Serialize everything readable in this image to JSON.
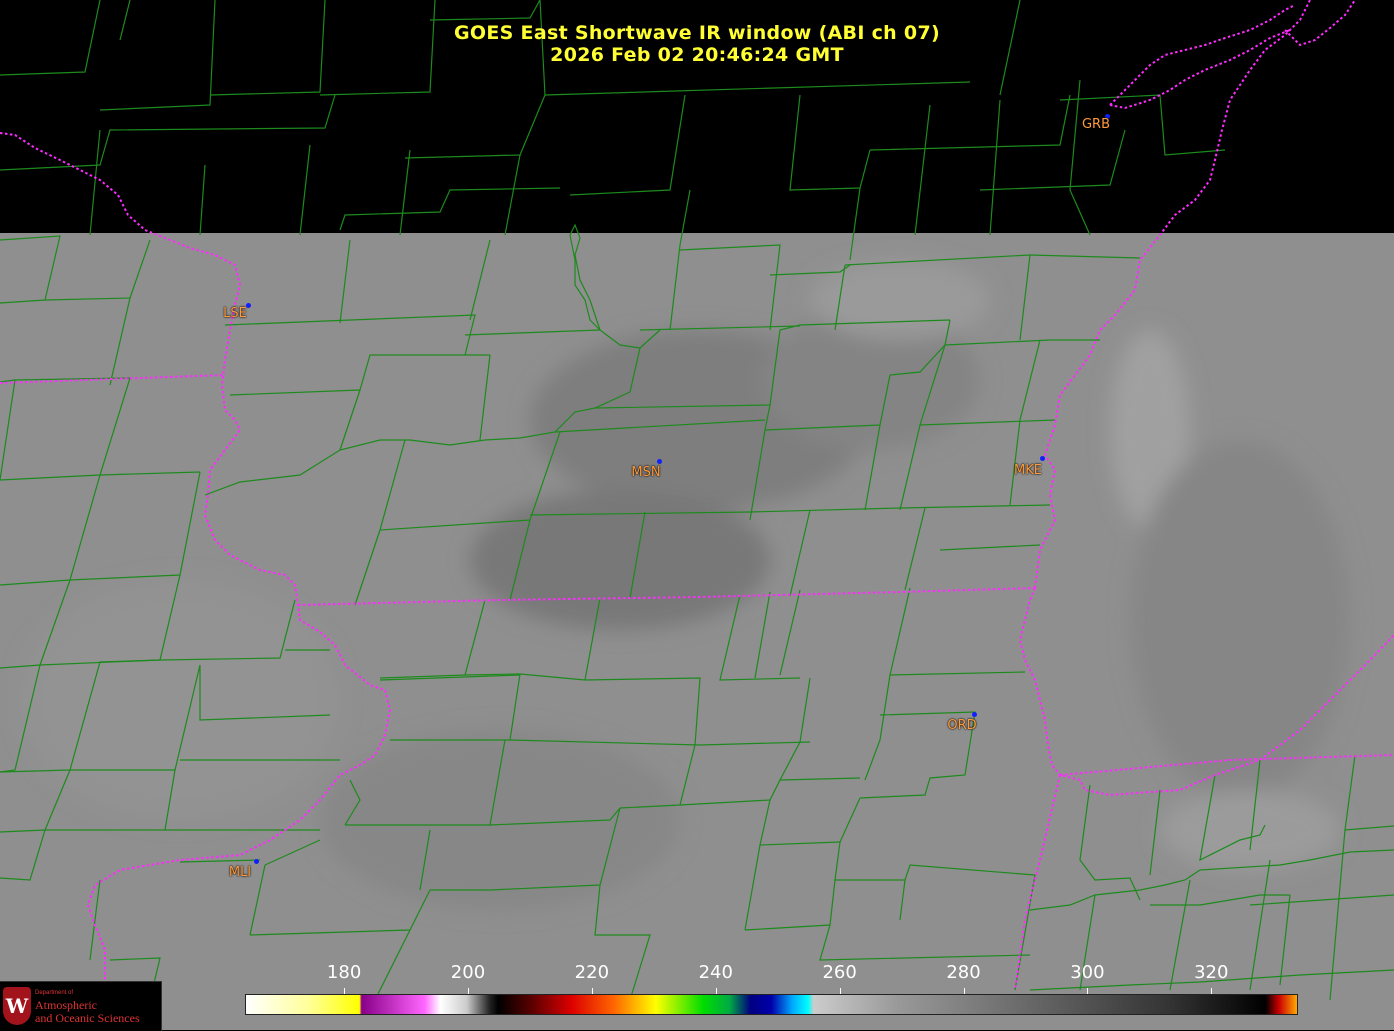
{
  "title": {
    "line1": "GOES East Shortwave IR window (ABI ch 07)",
    "line2": "2026 Feb 02  20:46:24 GMT"
  },
  "colors": {
    "background": "#000000",
    "cloud_gray": "#8f8f8f",
    "county_lines": "#1d8a1d",
    "state_lines": "#ff2bff",
    "station_label": "#ff9a3c",
    "station_dot": "#1020ff",
    "title_text": "#ffff33"
  },
  "stations": [
    {
      "id": "GRB"
    },
    {
      "id": "LSE"
    },
    {
      "id": "MSN"
    },
    {
      "id": "MKE"
    },
    {
      "id": "ORD"
    },
    {
      "id": "MLI"
    }
  ],
  "colorbar": {
    "unit_scale_min": 164,
    "unit_scale_max": 334,
    "ticks": [
      "180",
      "200",
      "220",
      "240",
      "260",
      "280",
      "300",
      "320"
    ]
  },
  "logo": {
    "small_text": "Department of",
    "line1": "Atmospheric",
    "line2": "and Oceanic Sciences",
    "crest_letter": "W"
  }
}
